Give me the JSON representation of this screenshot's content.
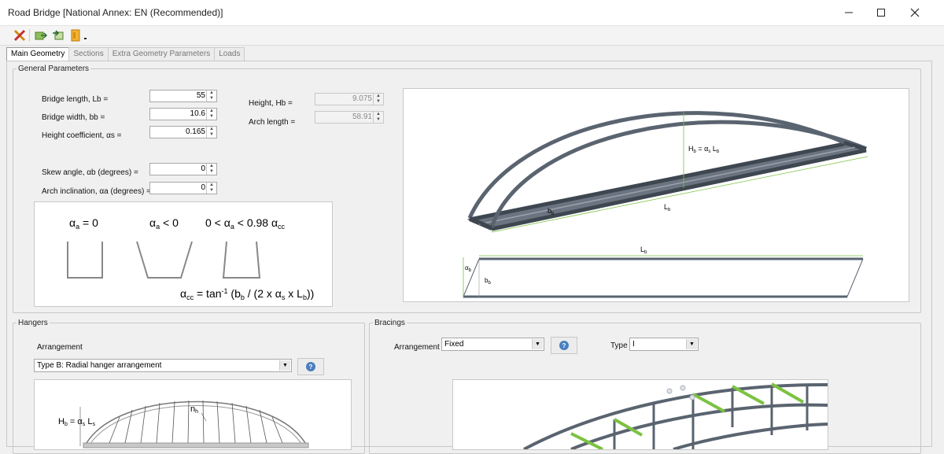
{
  "window": {
    "title": "Road Bridge [National Annex: EN (Recommended)]",
    "controls": [
      "minimize",
      "maximize",
      "close"
    ]
  },
  "toolbar": {
    "icons": [
      "tools-icon",
      "export-icon",
      "import-icon",
      "document-icon",
      "dropdown-arrow-icon"
    ]
  },
  "tabs": [
    {
      "label": "Main Geometry",
      "active": true
    },
    {
      "label": "Sections",
      "active": false
    },
    {
      "label": "Extra Geometry Parameters",
      "active": false
    },
    {
      "label": "Loads",
      "active": false
    }
  ],
  "general": {
    "legend": "General Parameters",
    "bridge_length_label": "Bridge length, Lb =",
    "bridge_length_value": "55",
    "bridge_width_label": "Bridge width, bb =",
    "bridge_width_value": "10.6",
    "height_coeff_label": "Height coefficient, αs =",
    "height_coeff_value": "0.165",
    "skew_label": "Skew angle, αb (degrees) =",
    "skew_value": "0",
    "arch_incl_label": "Arch inclination, αa (degrees) =",
    "arch_incl_value": "0",
    "height_label": "Height, Hb =",
    "height_value": "9.075",
    "arch_length_label": "Arch length =",
    "arch_length_value": "58.91"
  },
  "incl_diagram": {
    "case1": "α",
    "case1_sub": "a",
    "case1_rest": " = 0",
    "case2": "α",
    "case2_sub": "a",
    "case2_rest": " < 0",
    "case3_a": "0 < α",
    "case3_sub": "a",
    "case3_b": " < 0.98 α",
    "case3_sub2": "cc",
    "formula_a": "α",
    "formula_sub": "cc",
    "formula_b": " = tan",
    "formula_sup": "-1",
    "formula_c": " (b",
    "formula_sub2": "b",
    "formula_d": " / (2 x α",
    "formula_sub3": "s",
    "formula_e": " x L",
    "formula_sub4": "b",
    "formula_f": "))"
  },
  "model": {
    "height_label": "H",
    "height_sub1": "b",
    "height_eq": " = α",
    "height_sub2": "s",
    "height_rest": " L",
    "height_sub3": "b",
    "width_label": "b",
    "width_sub": "b",
    "length_label": "L",
    "length_sub": "b",
    "plan_length_label": "L",
    "plan_length_sub": "b",
    "plan_alpha_label": "α",
    "plan_alpha_sub": "b",
    "plan_width_label": "b",
    "plan_width_sub": "b"
  },
  "hangers": {
    "legend": "Hangers",
    "arrangement_label": "Arrangement",
    "arrangement_value": "Type B: Radial hanger arrangement",
    "diagram_height_label": "H",
    "diagram_height_sub": "b",
    "diagram_height_rest": " = α",
    "diagram_height_sub2": "s",
    "diagram_height_rest2": " L",
    "diagram_height_sub3": "s",
    "diagram_nh_label": "n",
    "diagram_nh_sub": "h"
  },
  "bracings": {
    "legend": "Bracings",
    "arrangement_label": "Arrangement",
    "arrangement_value": "Fixed",
    "type_label": "Type",
    "type_value": "I"
  },
  "colors": {
    "member": "#5a6470",
    "member_dark": "#3e4650",
    "bracing_green": "#7cc241",
    "accent_blue": "#4a7fc0"
  }
}
